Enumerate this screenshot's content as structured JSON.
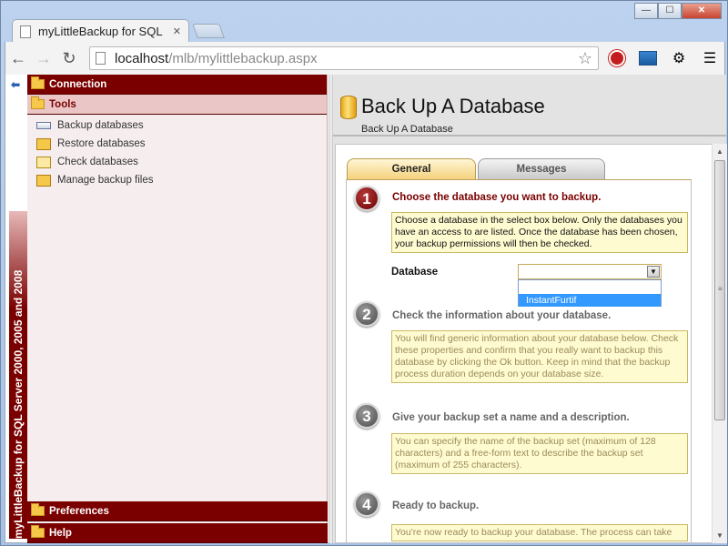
{
  "browser": {
    "tab_title": "myLittleBackup for SQL Se",
    "url_host": "localhost",
    "url_path": "/mlb/mylittlebackup.aspx"
  },
  "sidebar": {
    "banner": "myLittleBackup for SQL Server 2000, 2005 and 2008",
    "sections": {
      "connection": "Connection",
      "tools": "Tools",
      "preferences": "Preferences",
      "help": "Help"
    },
    "tools_items": [
      {
        "label": "Backup databases",
        "icon": "backup-icon"
      },
      {
        "label": "Restore databases",
        "icon": "restore-icon"
      },
      {
        "label": "Check databases",
        "icon": "check-icon"
      },
      {
        "label": "Manage backup files",
        "icon": "manage-files-icon"
      }
    ]
  },
  "main": {
    "title": "Back Up A Database",
    "breadcrumb": "Back Up A Database",
    "tabs": [
      "General",
      "Messages"
    ],
    "steps": [
      {
        "number": "1",
        "title": "Choose the database you want to backup.",
        "note": "Choose a database in the select box below. Only the databases you have an access to are listed. Once the database has been chosen, your backup permissions will then be checked."
      },
      {
        "number": "2",
        "title": "Check the information about your database.",
        "note": "You will find generic information about your database below. Check these properties and confirm that you really want to backup this database by clicking the Ok button. Keep in mind that the backup process duration depends on your database size."
      },
      {
        "number": "3",
        "title": "Give your backup set a name and a description.",
        "note": "You can specify the name of the backup set (maximum of 128 characters) and a free-form text to describe the backup set (maximum of 255 characters)."
      },
      {
        "number": "4",
        "title": "Ready to backup.",
        "note": "You're now ready to backup your database. The process can take"
      }
    ],
    "database_label": "Database",
    "database_value": "",
    "database_options": [
      "",
      "InstantFurtif"
    ]
  },
  "colors": {
    "accent": "#7a0000",
    "note_bg": "#fffbd0",
    "selection": "#3399ff"
  }
}
